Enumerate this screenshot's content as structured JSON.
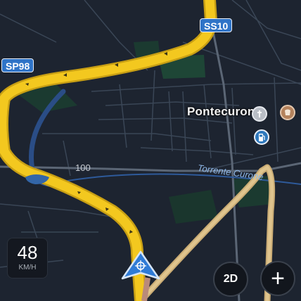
{
  "shields": {
    "sp98": "SP98",
    "ss10": "SS10"
  },
  "place_label": "Pontecurone",
  "road_number": "100",
  "river_label": "Torrente Curone",
  "speed": {
    "value": "48",
    "unit": "KM/H"
  },
  "buttons": {
    "view_mode": "2D",
    "zoom_in": "+"
  },
  "poi": {
    "church": "church-icon",
    "shop": "shop-icon",
    "fuel": "fuel-station-icon"
  },
  "colors": {
    "route": "#f2c51f",
    "background": "#1d2430",
    "water": "#2c4f86",
    "shield": "#2f74c8",
    "park": "#1f4a38",
    "position_arrow": "#2f7bd6"
  }
}
